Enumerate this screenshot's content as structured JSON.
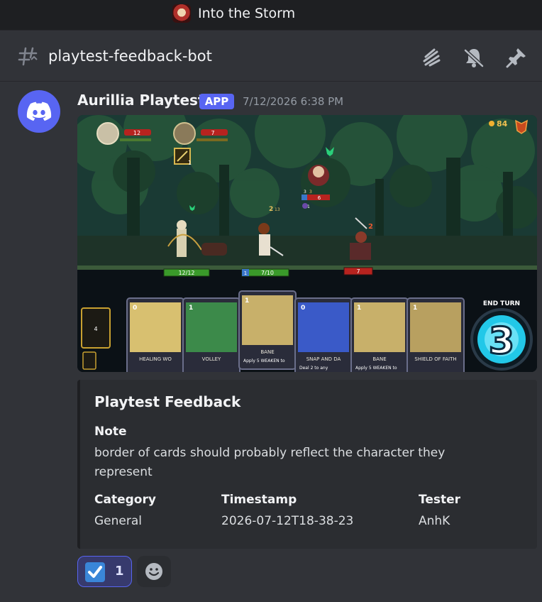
{
  "window": {
    "title": "Into the Storm"
  },
  "channel": {
    "name": "playtest-feedback-bot"
  },
  "header_icons": [
    "threads-icon",
    "mute-bell-icon",
    "pin-icon"
  ],
  "message": {
    "author": "Aurillia Playtest",
    "badge": "APP",
    "timestamp": "7/12/2026 6:38 PM"
  },
  "game": {
    "gold": "84",
    "ally1_hp": "12",
    "ally2_hp": "7",
    "ally_buff": "1",
    "enemy_top_hp": "6",
    "enemy_top_shield": "3",
    "enemy_top_intent": "3",
    "enemy_top_debuff": "1",
    "hero_atk": "2",
    "hero_atk_sub": "13",
    "enemy_intent": "2",
    "archer_hp": "12/12",
    "hero_hp": "7/10",
    "hero_block": "1",
    "enemy_hp": "7",
    "deck_count": "4",
    "end_turn_label": "END TURN",
    "energy": "3",
    "cards": [
      {
        "cost": "0",
        "name": "HEALING WO",
        "text": "",
        "color": "#d8c070"
      },
      {
        "cost": "1",
        "name": "VOLLEY",
        "text": "",
        "color": "#3c8a4a"
      },
      {
        "cost": "1",
        "name": "BANE",
        "text": "Apply 5 WEAKEN to",
        "color": "#c8b06a"
      },
      {
        "cost": "0",
        "name": "SNAP AND DA",
        "text": "Deal 2 to any",
        "color": "#3a5ac8"
      },
      {
        "cost": "1",
        "name": "BANE",
        "text": "Apply 5 WEAKEN to",
        "color": "#c8b06a"
      },
      {
        "cost": "1",
        "name": "SHIELD OF FAITH",
        "text": "",
        "color": "#b8a060"
      }
    ]
  },
  "embed": {
    "title": "Playtest Feedback",
    "note_label": "Note",
    "note_value": "border of cards should probably reflect the character they represent",
    "fields": [
      {
        "name": "Category",
        "value": "General"
      },
      {
        "name": "Timestamp",
        "value": "2026-07-12T18-38-23"
      },
      {
        "name": "Tester",
        "value": "AnhK"
      }
    ]
  },
  "reactions": [
    {
      "emoji": "check-mark-icon",
      "count": "1"
    }
  ],
  "colors": {
    "background": "#313338",
    "titlebar": "#1e1f22",
    "accent": "#5865f2",
    "embed_bg": "#2b2d31"
  }
}
